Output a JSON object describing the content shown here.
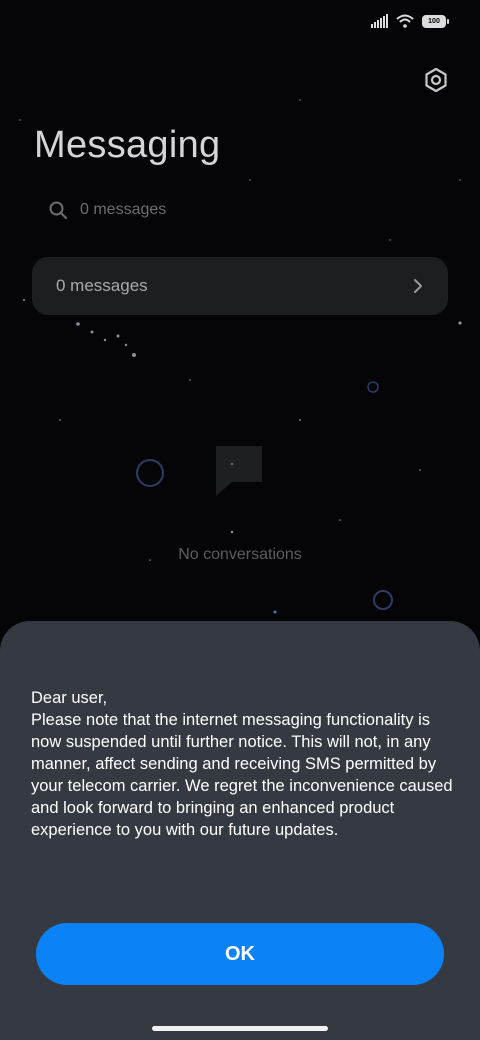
{
  "status_bar": {
    "battery_level": "100",
    "icons": [
      "signal-icon",
      "wifi-icon",
      "battery-icon"
    ]
  },
  "header": {
    "title": "Messaging",
    "settings_icon": "gear-icon"
  },
  "search": {
    "icon": "search-icon",
    "placeholder": "0 messages"
  },
  "messages_card": {
    "label": "0 messages",
    "icon": "chevron-right-icon"
  },
  "empty_state": {
    "icon": "chat-bubble-icon",
    "text": "No conversations"
  },
  "dialog": {
    "message": "Dear user,\nPlease note that the internet messaging functionality is now suspended until further notice. This will not, in any manner, affect sending and receiving SMS permitted by your telecom carrier. We regret the inconvenience caused and look forward to bringing an enhanced product experience to you with our future updates.",
    "ok_label": "OK"
  },
  "colors": {
    "background": "#050507",
    "sheet": "#353941",
    "accent": "#0b82f6",
    "card": "#1d1e21"
  }
}
